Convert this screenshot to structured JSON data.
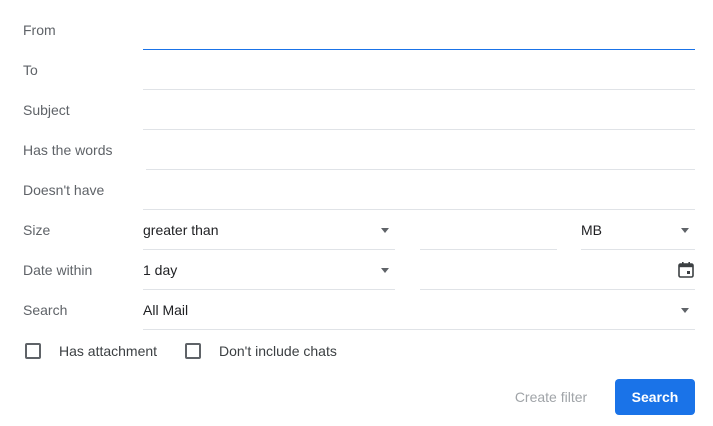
{
  "form": {
    "from": {
      "label": "From",
      "value": ""
    },
    "to": {
      "label": "To",
      "value": ""
    },
    "subject": {
      "label": "Subject",
      "value": ""
    },
    "has_words": {
      "label": "Has the words",
      "value": ""
    },
    "doesnt_have": {
      "label": "Doesn't have",
      "value": ""
    },
    "size": {
      "label": "Size",
      "comparator": "greater than",
      "amount": "",
      "unit": "MB"
    },
    "date_within": {
      "label": "Date within",
      "value": "1 day",
      "date": ""
    },
    "search_in": {
      "label": "Search",
      "value": "All Mail"
    }
  },
  "options": {
    "has_attachment": "Has attachment",
    "no_chats": "Don't include chats"
  },
  "actions": {
    "create_filter": "Create filter",
    "search": "Search"
  },
  "colors": {
    "accent": "#1a73e8",
    "label": "#5f6368",
    "divider": "#e0e3e7"
  },
  "icons": {
    "calendar": "calendar-icon",
    "dropdown": "caret-down-icon"
  }
}
